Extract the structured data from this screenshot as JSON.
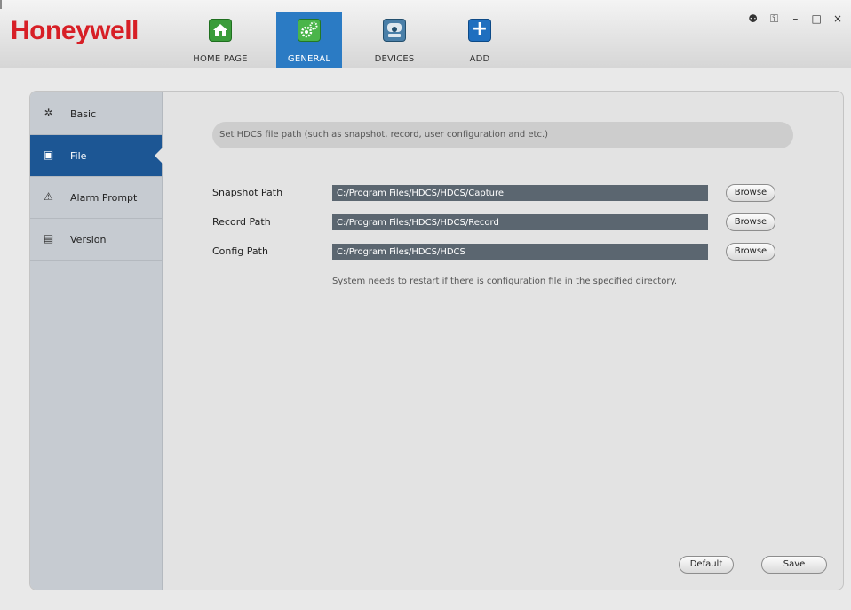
{
  "app": {
    "brand": "Honeywell"
  },
  "nav": {
    "tabs": [
      {
        "label": "HOME PAGE",
        "icon": "home-icon"
      },
      {
        "label": "GENERAL",
        "icon": "gear-icon",
        "active": true
      },
      {
        "label": "DEVICES",
        "icon": "devices-icon"
      },
      {
        "label": "ADD",
        "icon": "add-icon",
        "glyph": "+"
      }
    ]
  },
  "window_controls": {
    "user": "⚉",
    "lock": "⚿",
    "minimize": "–",
    "maximize": "□",
    "close": "×"
  },
  "sidebar": {
    "items": [
      {
        "label": "Basic",
        "icon": "gear-icon",
        "glyph": "✲"
      },
      {
        "label": "File",
        "icon": "save-icon",
        "glyph": "▣",
        "active": true
      },
      {
        "label": "Alarm Prompt",
        "icon": "warning-icon",
        "glyph": "⚠"
      },
      {
        "label": "Version",
        "icon": "document-icon",
        "glyph": "▤"
      }
    ]
  },
  "file": {
    "hint": "Set HDCS file path (such as snapshot, record, user configuration and etc.)",
    "paths": [
      {
        "label": "Snapshot Path",
        "value": "C:/Program Files/HDCS/HDCS/Capture",
        "button": "Browse"
      },
      {
        "label": "Record Path",
        "value": "C:/Program Files/HDCS/HDCS/Record",
        "button": "Browse"
      },
      {
        "label": "Config Path",
        "value": "C:/Program Files/HDCS/HDCS",
        "button": "Browse"
      }
    ],
    "note": "System needs to restart if there is configuration file in the specified directory."
  },
  "actions": {
    "default_label": "Default",
    "save_label": "Save"
  },
  "colors": {
    "brand_red": "#d71f26",
    "active_tab": "#2b7bc4",
    "sidebar_active": "#1c5694",
    "path_field": "#5b6670"
  }
}
